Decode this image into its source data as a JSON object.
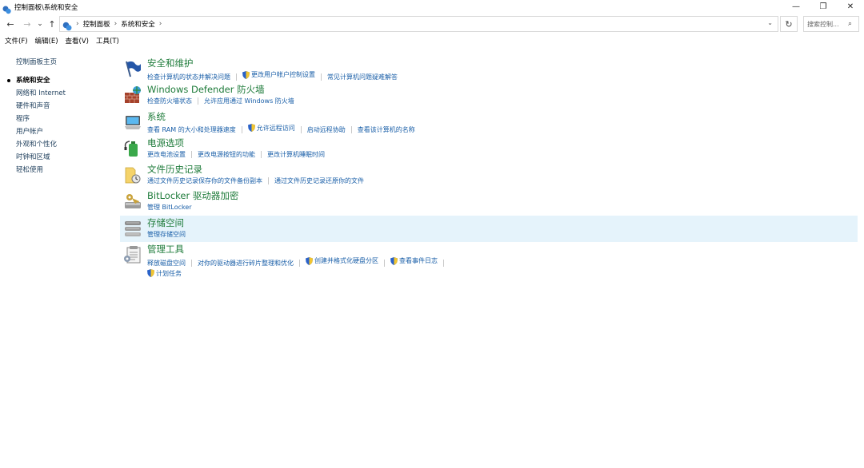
{
  "window": {
    "title": "控制面板\\系统和安全",
    "minimize": "—",
    "restore": "❐",
    "close": "✕"
  },
  "nav": {
    "back": "←",
    "forward": "→",
    "recent": "⌄",
    "up": "↑",
    "refresh": "↻",
    "dropdown": "⌄"
  },
  "address": {
    "crumbs": [
      "控制面板",
      "系统和安全"
    ],
    "sep": "›"
  },
  "search": {
    "placeholder": "搜索控制...",
    "icon": "⌕"
  },
  "menu": [
    "文件(F)",
    "编辑(E)",
    "查看(V)",
    "工具(T)"
  ],
  "sidebar": {
    "home": "控制面板主页",
    "items": [
      "系统和安全",
      "网络和 Internet",
      "硬件和声音",
      "程序",
      "用户帐户",
      "外观和个性化",
      "时钟和区域",
      "轻松使用"
    ],
    "active_index": 0
  },
  "categories": [
    {
      "title": "安全和维护",
      "links": [
        "检查计算机的状态并解决问题",
        "更改用户帐户控制设置",
        "常见计算机问题疑难解答"
      ]
    },
    {
      "title": "Windows Defender 防火墙",
      "links": [
        "检查防火墙状态",
        "允许应用通过 Windows 防火墙"
      ]
    },
    {
      "title": "系统",
      "links": [
        "查看 RAM 的大小和处理器速度",
        "允许远程访问",
        "启动远程协助",
        "查看该计算机的名称"
      ]
    },
    {
      "title": "电源选项",
      "links": [
        "更改电池设置",
        "更改电源按钮的功能",
        "更改计算机睡眠时间"
      ]
    },
    {
      "title": "文件历史记录",
      "links": [
        "通过文件历史记录保存你的文件备份副本",
        "通过文件历史记录还原你的文件"
      ]
    },
    {
      "title": "BitLocker 驱动器加密",
      "links": [
        "管理 BitLocker"
      ]
    },
    {
      "title": "存储空间",
      "links": [
        "管理存储空间"
      ]
    },
    {
      "title": "管理工具",
      "links": [
        "释放磁盘空间",
        "对你的驱动器进行碎片整理和优化",
        "创建并格式化硬盘分区",
        "查看事件日志",
        "计划任务"
      ]
    }
  ],
  "colors": {
    "link": "#1a5fa8",
    "category_title": "#1e7b3a",
    "hover_bg": "#e5f3fb"
  }
}
